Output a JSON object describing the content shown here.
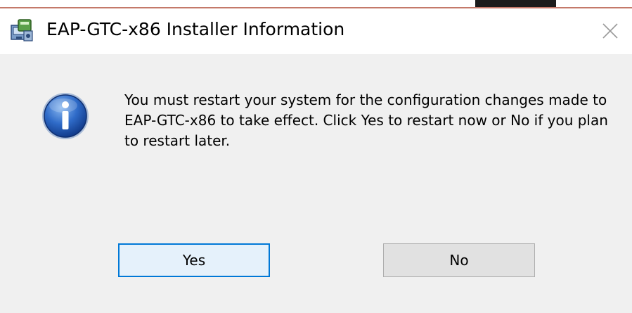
{
  "window": {
    "title": "EAP-GTC-x86 Installer Information",
    "app_icon": "installer-icon",
    "close_icon": "close-icon"
  },
  "dialog": {
    "icon": "information-icon",
    "message": "You must restart your system for the configuration changes made to EAP-GTC-x86 to take effect. Click Yes to restart now or No if you plan to restart later."
  },
  "buttons": {
    "yes_label": "Yes",
    "no_label": "No"
  },
  "colors": {
    "accent": "#0078d7",
    "dialog_bg": "#f0f0f0",
    "button_bg": "#e1e1e1"
  }
}
